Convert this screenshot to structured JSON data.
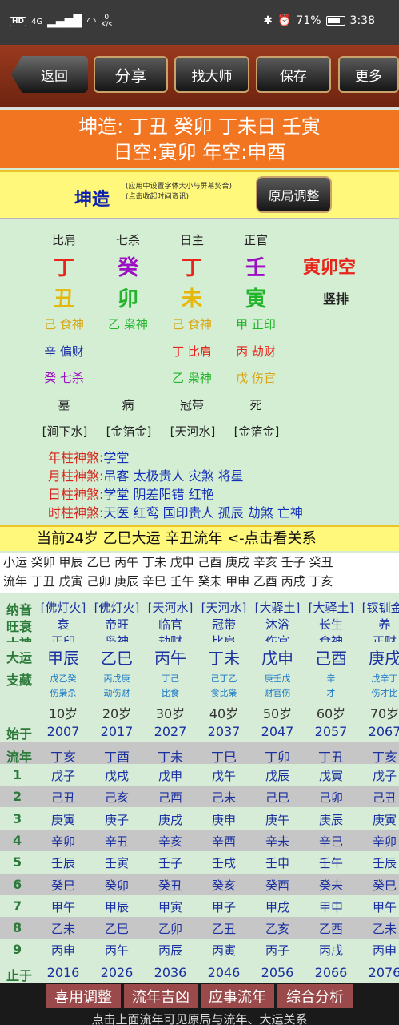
{
  "status": {
    "network": "4G",
    "speed_top": "0",
    "speed_unit": "K/s",
    "battery": "71%",
    "time": "3:38"
  },
  "toolbar": {
    "back": "返回",
    "share": "分享",
    "master": "找大师",
    "save": "保存",
    "more": "更多"
  },
  "header": {
    "line1": "坤造: 丁丑 癸卯 丁未日 壬寅",
    "line2": "日空:寅卯 年空:申酉"
  },
  "yellowbar": {
    "title": "坤造",
    "note1": "(应用中设置字体大小与屏幕契合)",
    "note2": "(点击收起时间资讯)",
    "adjust": "原局调整"
  },
  "chart": {
    "shishen": [
      "比肩",
      "七杀",
      "日主",
      "正官"
    ],
    "gan": [
      "丁",
      "癸",
      "丁",
      "壬"
    ],
    "kong": "寅卯空",
    "zhi": [
      "丑",
      "卯",
      "未",
      "寅"
    ],
    "shupai": "竖排",
    "hidden": [
      [
        "己 食神",
        "乙 枭神",
        "己 食神",
        "甲 正印"
      ],
      [
        "辛 偏财",
        "",
        "丁 比肩",
        "丙 劫财"
      ],
      [
        "癸 七杀",
        "",
        "乙 枭神",
        "戊 伤官"
      ]
    ],
    "changsheng": [
      "墓",
      "病",
      "冠带",
      "死"
    ],
    "nayin": [
      "[涧下水]",
      "[金箔金]",
      "[天河水]",
      "[金箔金]"
    ],
    "shensha": [
      {
        "label": "年柱神煞:",
        "value": "学堂"
      },
      {
        "label": "月柱神煞:",
        "value": "吊客 太极贵人 灾煞 将星"
      },
      {
        "label": "日柱神煞:",
        "value": "学堂  阴差阳错 红艳"
      },
      {
        "label": "时柱神煞:",
        "value": "天医 红鸾 国印贵人 孤辰 劫煞 亡神"
      }
    ]
  },
  "current": "当前24岁 乙巳大运 辛丑流年   <-点击看关系",
  "xiaoyun": {
    "line1": "小运 癸卯 甲辰 乙巳 丙午 丁未 戊申 己酉 庚戌 辛亥 壬子 癸丑",
    "line2": "流年 丁丑 戊寅 己卯 庚辰 辛巳 壬午 癸未 甲申 乙酉 丙戌 丁亥"
  },
  "dayun": {
    "labels": {
      "nayin": "纳音",
      "wangshuai": "旺衰",
      "shishen": "十神",
      "dayun": "大运",
      "zhicang": "支藏",
      "shiyu": "始于",
      "liunian": "流年",
      "zhiyu": "止于"
    },
    "nayin": [
      "[佛灯火]",
      "[佛灯火]",
      "[天河水]",
      "[天河水]",
      "[大驿土]",
      "[大驿土]",
      "[钗钏金]"
    ],
    "wangshuai": [
      "衰",
      "帝旺",
      "临官",
      "冠带",
      "沐浴",
      "长生",
      "养"
    ],
    "shishen": [
      "正印",
      "枭神",
      "劫财",
      "比肩",
      "伤官",
      "食神",
      "正财"
    ],
    "dayun": [
      "甲辰",
      "乙巳",
      "丙午",
      "丁未",
      "戊申",
      "己酉",
      "庚戌"
    ],
    "zhicang1": [
      "戊乙癸",
      "丙戊庚",
      "丁己",
      "己丁乙",
      "庚壬戊",
      "辛",
      "戊辛丁"
    ],
    "zhicang2": [
      "伤枭杀",
      "劫伤财",
      "比食",
      "食比枭",
      "财官伤",
      "才",
      "伤才比"
    ],
    "age": [
      "10岁",
      "20岁",
      "30岁",
      "40岁",
      "50岁",
      "60岁",
      "70岁"
    ],
    "start": [
      "2007",
      "2017",
      "2027",
      "2037",
      "2047",
      "2057",
      "2067"
    ],
    "liunian": [
      "丁亥",
      "丁酉",
      "丁未",
      "丁巳",
      "丁卯",
      "丁丑",
      "丁亥"
    ],
    "rows": [
      {
        "n": "1",
        "v": [
          "戊子",
          "戊戌",
          "戊申",
          "戊午",
          "戊辰",
          "戊寅",
          "戊子"
        ]
      },
      {
        "n": "2",
        "v": [
          "己丑",
          "己亥",
          "己酉",
          "己未",
          "己巳",
          "己卯",
          "己丑"
        ]
      },
      {
        "n": "3",
        "v": [
          "庚寅",
          "庚子",
          "庚戌",
          "庚申",
          "庚午",
          "庚辰",
          "庚寅"
        ]
      },
      {
        "n": "4",
        "v": [
          "辛卯",
          "辛丑",
          "辛亥",
          "辛酉",
          "辛未",
          "辛巳",
          "辛卯"
        ]
      },
      {
        "n": "5",
        "v": [
          "壬辰",
          "壬寅",
          "壬子",
          "壬戌",
          "壬申",
          "壬午",
          "壬辰"
        ]
      },
      {
        "n": "6",
        "v": [
          "癸巳",
          "癸卯",
          "癸丑",
          "癸亥",
          "癸酉",
          "癸未",
          "癸巳"
        ]
      },
      {
        "n": "7",
        "v": [
          "甲午",
          "甲辰",
          "甲寅",
          "甲子",
          "甲戌",
          "甲申",
          "甲午"
        ]
      },
      {
        "n": "8",
        "v": [
          "乙未",
          "乙巳",
          "乙卯",
          "乙丑",
          "乙亥",
          "乙酉",
          "乙未"
        ]
      },
      {
        "n": "9",
        "v": [
          "丙申",
          "丙午",
          "丙辰",
          "丙寅",
          "丙子",
          "丙戌",
          "丙申"
        ]
      }
    ],
    "end": [
      "2016",
      "2026",
      "2036",
      "2046",
      "2056",
      "2066",
      "2076"
    ]
  },
  "bottom": {
    "b1": "喜用调整",
    "b2": "流年吉凶",
    "b3": "应事流年",
    "b4": "综合分析",
    "footer": "点击上面流年可见原局与流年、大运关系"
  }
}
